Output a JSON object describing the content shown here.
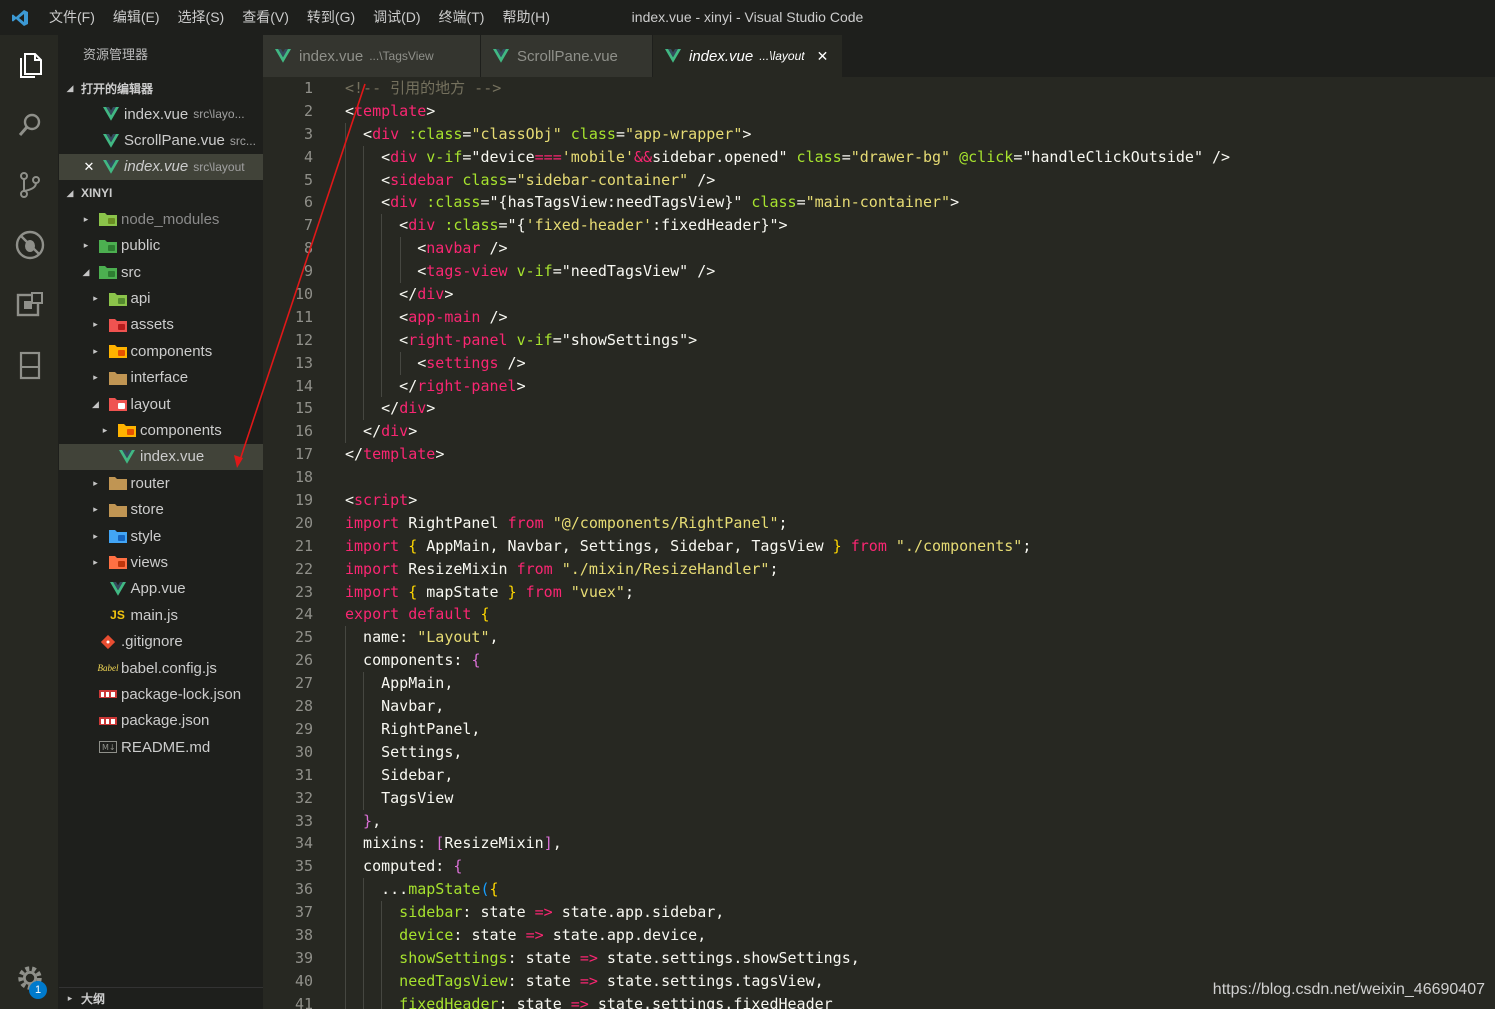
{
  "window": {
    "title": "index.vue - xinyi - Visual Studio Code",
    "menu": [
      "文件(F)",
      "编辑(E)",
      "选择(S)",
      "查看(V)",
      "转到(G)",
      "调试(D)",
      "终端(T)",
      "帮助(H)"
    ]
  },
  "activity": {
    "items": [
      "explorer-icon",
      "search-icon",
      "source-control-icon",
      "debug-icon",
      "extensions-icon",
      "remote-explorer-icon"
    ],
    "settings_badge": "1"
  },
  "sidebar": {
    "title": "资源管理器",
    "open_editors_label": "打开的编辑器",
    "open_editors": [
      {
        "name": "index.vue",
        "desc": "src\\layo...",
        "italic": false,
        "close": false
      },
      {
        "name": "ScrollPane.vue",
        "desc": "src...",
        "italic": false,
        "close": false
      },
      {
        "name": "index.vue",
        "desc": "src\\layout",
        "italic": true,
        "close": true
      }
    ],
    "project_label": "XINYI",
    "tree": [
      {
        "depth": 0,
        "twist": "▸",
        "icon": "node",
        "name": "node_modules",
        "dim": true
      },
      {
        "depth": 0,
        "twist": "▸",
        "icon": "public",
        "name": "public"
      },
      {
        "depth": 0,
        "twist": "◢",
        "icon": "src",
        "name": "src"
      },
      {
        "depth": 1,
        "twist": "▸",
        "icon": "api",
        "name": "api"
      },
      {
        "depth": 1,
        "twist": "▸",
        "icon": "assets",
        "name": "assets"
      },
      {
        "depth": 1,
        "twist": "▸",
        "icon": "components",
        "name": "components"
      },
      {
        "depth": 1,
        "twist": "▸",
        "icon": "folder",
        "name": "interface"
      },
      {
        "depth": 1,
        "twist": "◢",
        "icon": "layout",
        "name": "layout"
      },
      {
        "depth": 2,
        "twist": "▸",
        "icon": "components",
        "name": "components"
      },
      {
        "depth": 2,
        "twist": "",
        "icon": "vue",
        "name": "index.vue",
        "selected": true
      },
      {
        "depth": 1,
        "twist": "▸",
        "icon": "folder",
        "name": "router"
      },
      {
        "depth": 1,
        "twist": "▸",
        "icon": "folder",
        "name": "store"
      },
      {
        "depth": 1,
        "twist": "▸",
        "icon": "style",
        "name": "style"
      },
      {
        "depth": 1,
        "twist": "▸",
        "icon": "views",
        "name": "views"
      },
      {
        "depth": 1,
        "twist": "",
        "icon": "vue",
        "name": "App.vue"
      },
      {
        "depth": 1,
        "twist": "",
        "icon": "js",
        "name": "main.js"
      },
      {
        "depth": 0,
        "twist": "",
        "icon": "git",
        "name": ".gitignore"
      },
      {
        "depth": 0,
        "twist": "",
        "icon": "babel",
        "name": "babel.config.js"
      },
      {
        "depth": 0,
        "twist": "",
        "icon": "npm",
        "name": "package-lock.json"
      },
      {
        "depth": 0,
        "twist": "",
        "icon": "npm",
        "name": "package.json"
      },
      {
        "depth": 0,
        "twist": "",
        "icon": "md",
        "name": "README.md"
      }
    ],
    "outline_label": "大纲"
  },
  "tabs": [
    {
      "name": "index.vue",
      "desc": "...\\TagsView",
      "active": false
    },
    {
      "name": "ScrollPane.vue",
      "desc": "",
      "active": false
    },
    {
      "name": "index.vue",
      "desc": "...\\layout",
      "active": true
    }
  ],
  "editor": {
    "lines": [
      [
        [
          "c-com",
          "<!-- 引用的地方 -->"
        ]
      ],
      [
        [
          "c-punc",
          "<"
        ],
        [
          "c-tag",
          "template"
        ],
        [
          "c-punc",
          ">"
        ]
      ],
      [
        [
          "c-punc",
          "  <"
        ],
        [
          "c-tag",
          "div"
        ],
        [
          "c-attr",
          " :class"
        ],
        [
          "c-punc",
          "="
        ],
        [
          "c-str",
          "\"classObj\""
        ],
        [
          "c-attr",
          " class"
        ],
        [
          "c-punc",
          "="
        ],
        [
          "c-str",
          "\"app-wrapper\""
        ],
        [
          "c-punc",
          ">"
        ]
      ],
      [
        [
          "c-punc",
          "    <"
        ],
        [
          "c-tag",
          "div"
        ],
        [
          "c-attr",
          " v-if"
        ],
        [
          "c-punc",
          "=\""
        ],
        [
          "c-var",
          "device"
        ],
        [
          "c-kw",
          "==="
        ],
        [
          "c-str",
          "'mobile'"
        ],
        [
          "c-kw",
          "&&"
        ],
        [
          "c-var",
          "sidebar.opened"
        ],
        [
          "c-punc",
          "\""
        ],
        [
          "c-attr",
          " class"
        ],
        [
          "c-punc",
          "="
        ],
        [
          "c-str",
          "\"drawer-bg\""
        ],
        [
          "c-attr",
          " @click"
        ],
        [
          "c-punc",
          "=\""
        ],
        [
          "c-var",
          "handleClickOutside"
        ],
        [
          "c-punc",
          "\" />"
        ]
      ],
      [
        [
          "c-punc",
          "    <"
        ],
        [
          "c-tag",
          "sidebar"
        ],
        [
          "c-attr",
          " class"
        ],
        [
          "c-punc",
          "="
        ],
        [
          "c-str",
          "\"sidebar-container\""
        ],
        [
          "c-punc",
          " />"
        ]
      ],
      [
        [
          "c-punc",
          "    <"
        ],
        [
          "c-tag",
          "div"
        ],
        [
          "c-attr",
          " :class"
        ],
        [
          "c-punc",
          "=\"{"
        ],
        [
          "c-var",
          "hasTagsView"
        ],
        [
          "c-punc",
          ":"
        ],
        [
          "c-var",
          "needTagsView"
        ],
        [
          "c-punc",
          "}\""
        ],
        [
          "c-attr",
          " class"
        ],
        [
          "c-punc",
          "="
        ],
        [
          "c-str",
          "\"main-container\""
        ],
        [
          "c-punc",
          ">"
        ]
      ],
      [
        [
          "c-punc",
          "      <"
        ],
        [
          "c-tag",
          "div"
        ],
        [
          "c-attr",
          " :class"
        ],
        [
          "c-punc",
          "=\"{"
        ],
        [
          "c-str",
          "'fixed-header'"
        ],
        [
          "c-punc",
          ":"
        ],
        [
          "c-var",
          "fixedHeader"
        ],
        [
          "c-punc",
          "}\">"
        ]
      ],
      [
        [
          "c-punc",
          "        <"
        ],
        [
          "c-tag",
          "navbar"
        ],
        [
          "c-punc",
          " />"
        ]
      ],
      [
        [
          "c-punc",
          "        <"
        ],
        [
          "c-tag",
          "tags-view"
        ],
        [
          "c-attr",
          " v-if"
        ],
        [
          "c-punc",
          "=\""
        ],
        [
          "c-var",
          "needTagsView"
        ],
        [
          "c-punc",
          "\" />"
        ]
      ],
      [
        [
          "c-punc",
          "      </"
        ],
        [
          "c-tag",
          "div"
        ],
        [
          "c-punc",
          ">"
        ]
      ],
      [
        [
          "c-punc",
          "      <"
        ],
        [
          "c-tag",
          "app-main"
        ],
        [
          "c-punc",
          " />"
        ]
      ],
      [
        [
          "c-punc",
          "      <"
        ],
        [
          "c-tag",
          "right-panel"
        ],
        [
          "c-attr",
          " v-if"
        ],
        [
          "c-punc",
          "=\""
        ],
        [
          "c-var",
          "showSettings"
        ],
        [
          "c-punc",
          "\">"
        ]
      ],
      [
        [
          "c-punc",
          "        <"
        ],
        [
          "c-tag",
          "settings"
        ],
        [
          "c-punc",
          " />"
        ]
      ],
      [
        [
          "c-punc",
          "      </"
        ],
        [
          "c-tag",
          "right-panel"
        ],
        [
          "c-punc",
          ">"
        ]
      ],
      [
        [
          "c-punc",
          "    </"
        ],
        [
          "c-tag",
          "div"
        ],
        [
          "c-punc",
          ">"
        ]
      ],
      [
        [
          "c-punc",
          "  </"
        ],
        [
          "c-tag",
          "div"
        ],
        [
          "c-punc",
          ">"
        ]
      ],
      [
        [
          "c-punc",
          "</"
        ],
        [
          "c-tag",
          "template"
        ],
        [
          "c-punc",
          ">"
        ]
      ],
      [],
      [
        [
          "c-punc",
          "<"
        ],
        [
          "c-tag",
          "script"
        ],
        [
          "c-punc",
          ">"
        ]
      ],
      [
        [
          "c-kw",
          "import"
        ],
        [
          "c-var",
          " RightPanel "
        ],
        [
          "c-kw",
          "from"
        ],
        [
          "c-str",
          " \"@/components/RightPanel\""
        ],
        [
          "c-punc",
          ";"
        ]
      ],
      [
        [
          "c-kw",
          "import"
        ],
        [
          "b1",
          " {"
        ],
        [
          "c-var",
          " AppMain, Navbar, Settings, Sidebar, TagsView "
        ],
        [
          "b1",
          "}"
        ],
        [
          "c-kw",
          " from"
        ],
        [
          "c-str",
          " \"./components\""
        ],
        [
          "c-punc",
          ";"
        ]
      ],
      [
        [
          "c-kw",
          "import"
        ],
        [
          "c-var",
          " ResizeMixin "
        ],
        [
          "c-kw",
          "from"
        ],
        [
          "c-str",
          " \"./mixin/ResizeHandler\""
        ],
        [
          "c-punc",
          ";"
        ]
      ],
      [
        [
          "c-kw",
          "import"
        ],
        [
          "b1",
          " {"
        ],
        [
          "c-var",
          " mapState "
        ],
        [
          "b1",
          "}"
        ],
        [
          "c-kw",
          " from"
        ],
        [
          "c-str",
          " \"vuex\""
        ],
        [
          "c-punc",
          ";"
        ]
      ],
      [
        [
          "c-kw",
          "export default"
        ],
        [
          "b1",
          " {"
        ]
      ],
      [
        [
          "c-prop",
          "  name: "
        ],
        [
          "c-str",
          "\"Layout\""
        ],
        [
          "c-punc",
          ","
        ]
      ],
      [
        [
          "c-prop",
          "  components: "
        ],
        [
          "b2",
          "{"
        ]
      ],
      [
        [
          "c-var",
          "    AppMain,"
        ]
      ],
      [
        [
          "c-var",
          "    Navbar,"
        ]
      ],
      [
        [
          "c-var",
          "    RightPanel,"
        ]
      ],
      [
        [
          "c-var",
          "    Settings,"
        ]
      ],
      [
        [
          "c-var",
          "    Sidebar,"
        ]
      ],
      [
        [
          "c-var",
          "    TagsView"
        ]
      ],
      [
        [
          "b2",
          "  }"
        ],
        [
          "c-punc",
          ","
        ]
      ],
      [
        [
          "c-prop",
          "  mixins: "
        ],
        [
          "b2",
          "["
        ],
        [
          "c-var",
          "ResizeMixin"
        ],
        [
          "b2",
          "]"
        ],
        [
          "c-punc",
          ","
        ]
      ],
      [
        [
          "c-prop",
          "  computed: "
        ],
        [
          "b2",
          "{"
        ]
      ],
      [
        [
          "c-punc",
          "    ..."
        ],
        [
          "c-fn",
          "mapState"
        ],
        [
          "b3",
          "("
        ],
        [
          "b1",
          "{"
        ]
      ],
      [
        [
          "c-fn",
          "      sidebar"
        ],
        [
          "c-punc",
          ": "
        ],
        [
          "c-var",
          "state "
        ],
        [
          "c-kw",
          "=>"
        ],
        [
          "c-var",
          " state.app.sidebar,"
        ]
      ],
      [
        [
          "c-fn",
          "      device"
        ],
        [
          "c-punc",
          ": "
        ],
        [
          "c-var",
          "state "
        ],
        [
          "c-kw",
          "=>"
        ],
        [
          "c-var",
          " state.app.device,"
        ]
      ],
      [
        [
          "c-fn",
          "      showSettings"
        ],
        [
          "c-punc",
          ": "
        ],
        [
          "c-var",
          "state "
        ],
        [
          "c-kw",
          "=>"
        ],
        [
          "c-var",
          " state.settings.showSettings,"
        ]
      ],
      [
        [
          "c-fn",
          "      needTagsView"
        ],
        [
          "c-punc",
          ": "
        ],
        [
          "c-var",
          "state "
        ],
        [
          "c-kw",
          "=>"
        ],
        [
          "c-var",
          " state.settings.tagsView,"
        ]
      ],
      [
        [
          "c-fn",
          "      fixedHeader"
        ],
        [
          "c-punc",
          ": "
        ],
        [
          "c-var",
          "state "
        ],
        [
          "c-kw",
          "=>"
        ],
        [
          "c-var",
          " state.settings.fixedHeader"
        ]
      ]
    ]
  },
  "watermark": "https://blog.csdn.net/weixin_46690407"
}
